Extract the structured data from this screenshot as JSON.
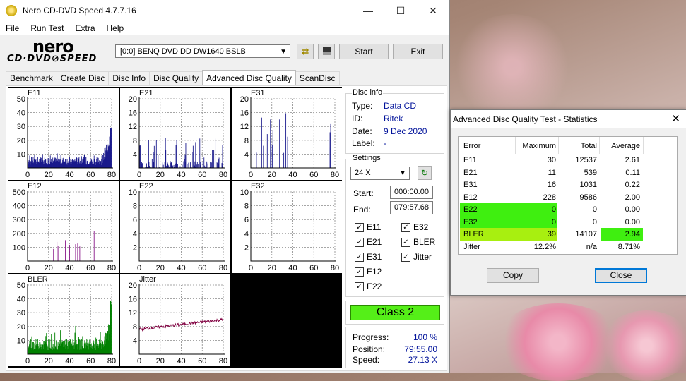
{
  "window": {
    "title": "Nero CD-DVD Speed 4.7.7.16"
  },
  "menu": [
    "File",
    "Run Test",
    "Extra",
    "Help"
  ],
  "logo": {
    "top": "nero",
    "bottom": "CD·DVD⊘SPEED"
  },
  "toolbar": {
    "drive": "[0:0]   BENQ DVD DD DW1640 BSLB",
    "start": "Start",
    "exit": "Exit"
  },
  "tabs": [
    "Benchmark",
    "Create Disc",
    "Disc Info",
    "Disc Quality",
    "Advanced Disc Quality",
    "ScanDisc"
  ],
  "disc_info": {
    "title": "Disc info",
    "type_label": "Type:",
    "type": "Data CD",
    "id_label": "ID:",
    "id": "Ritek",
    "date_label": "Date:",
    "date": "9 Dec 2020",
    "label_label": "Label:",
    "label": "-"
  },
  "settings": {
    "title": "Settings",
    "speed": "24 X",
    "start_label": "Start:",
    "start": "000:00.00",
    "end_label": "End:",
    "end": "079:57.68"
  },
  "checkboxes": {
    "e11": "E11",
    "e32": "E32",
    "e21": "E21",
    "bler": "BLER",
    "e31": "E31",
    "jitter": "Jitter",
    "e12": "E12",
    "e22": "E22"
  },
  "class": "Class 2",
  "progress": {
    "progress_label": "Progress:",
    "progress": "100 %",
    "position_label": "Position:",
    "position": "79:55.00",
    "speed_label": "Speed:",
    "speed": "27.13 X"
  },
  "dialog": {
    "title": "Advanced Disc Quality Test - Statistics",
    "headers": {
      "error": "Error",
      "maximum": "Maximum",
      "total": "Total",
      "average": "Average"
    },
    "rows": [
      {
        "error": "E11",
        "maximum": "30",
        "total": "12537",
        "average": "2.61"
      },
      {
        "error": "E21",
        "maximum": "11",
        "total": "539",
        "average": "0.11"
      },
      {
        "error": "E31",
        "maximum": "16",
        "total": "1031",
        "average": "0.22"
      },
      {
        "error": "E12",
        "maximum": "228",
        "total": "9586",
        "average": "2.00"
      },
      {
        "error": "E22",
        "maximum": "0",
        "total": "0",
        "average": "0.00"
      },
      {
        "error": "E32",
        "maximum": "0",
        "total": "0",
        "average": "0.00"
      },
      {
        "error": "BLER",
        "maximum": "39",
        "total": "14107",
        "average": "2.94"
      },
      {
        "error": "Jitter",
        "maximum": "12.2%",
        "total": "n/a",
        "average": "8.71%"
      }
    ],
    "copy": "Copy",
    "close": "Close"
  },
  "chart_data": [
    {
      "type": "bar",
      "title": "E11",
      "ylim": [
        0,
        50
      ],
      "yticks": [
        10,
        20,
        30,
        40,
        50
      ],
      "xticks": [
        0,
        20,
        40,
        60,
        80
      ],
      "color": "#1a1a8c"
    },
    {
      "type": "bar",
      "title": "E21",
      "ylim": [
        0,
        20
      ],
      "yticks": [
        4,
        8,
        12,
        16,
        20
      ],
      "xticks": [
        0,
        20,
        40,
        60,
        80
      ],
      "color": "#1a1a8c"
    },
    {
      "type": "bar",
      "title": "E31",
      "ylim": [
        0,
        20
      ],
      "yticks": [
        4,
        8,
        12,
        16,
        20
      ],
      "xticks": [
        0,
        20,
        40,
        60,
        80
      ],
      "color": "#1a1a8c"
    },
    {
      "type": "bar",
      "title": "E12",
      "ylim": [
        0,
        500
      ],
      "yticks": [
        100,
        200,
        300,
        400,
        500
      ],
      "xticks": [
        0,
        20,
        40,
        60,
        80
      ],
      "color": "#8b1a8b"
    },
    {
      "type": "bar",
      "title": "E22",
      "ylim": [
        0,
        10
      ],
      "yticks": [
        2,
        4,
        6,
        8,
        10
      ],
      "xticks": [
        0,
        20,
        40,
        60,
        80
      ],
      "color": "#8b1a8b"
    },
    {
      "type": "bar",
      "title": "E32",
      "ylim": [
        0,
        10
      ],
      "yticks": [
        2,
        4,
        6,
        8,
        10
      ],
      "xticks": [
        0,
        20,
        40,
        60,
        80
      ],
      "color": "#8b1a8b"
    },
    {
      "type": "bar",
      "title": "BLER",
      "ylim": [
        0,
        50
      ],
      "yticks": [
        10,
        20,
        30,
        40,
        50
      ],
      "xticks": [
        0,
        20,
        40,
        60,
        80
      ],
      "color": "#008000"
    },
    {
      "type": "line",
      "title": "Jitter",
      "ylim": [
        0,
        20
      ],
      "yticks": [
        4,
        8,
        12,
        16,
        20
      ],
      "xticks": [
        0,
        20,
        40,
        60,
        80
      ],
      "color": "#800040"
    }
  ]
}
